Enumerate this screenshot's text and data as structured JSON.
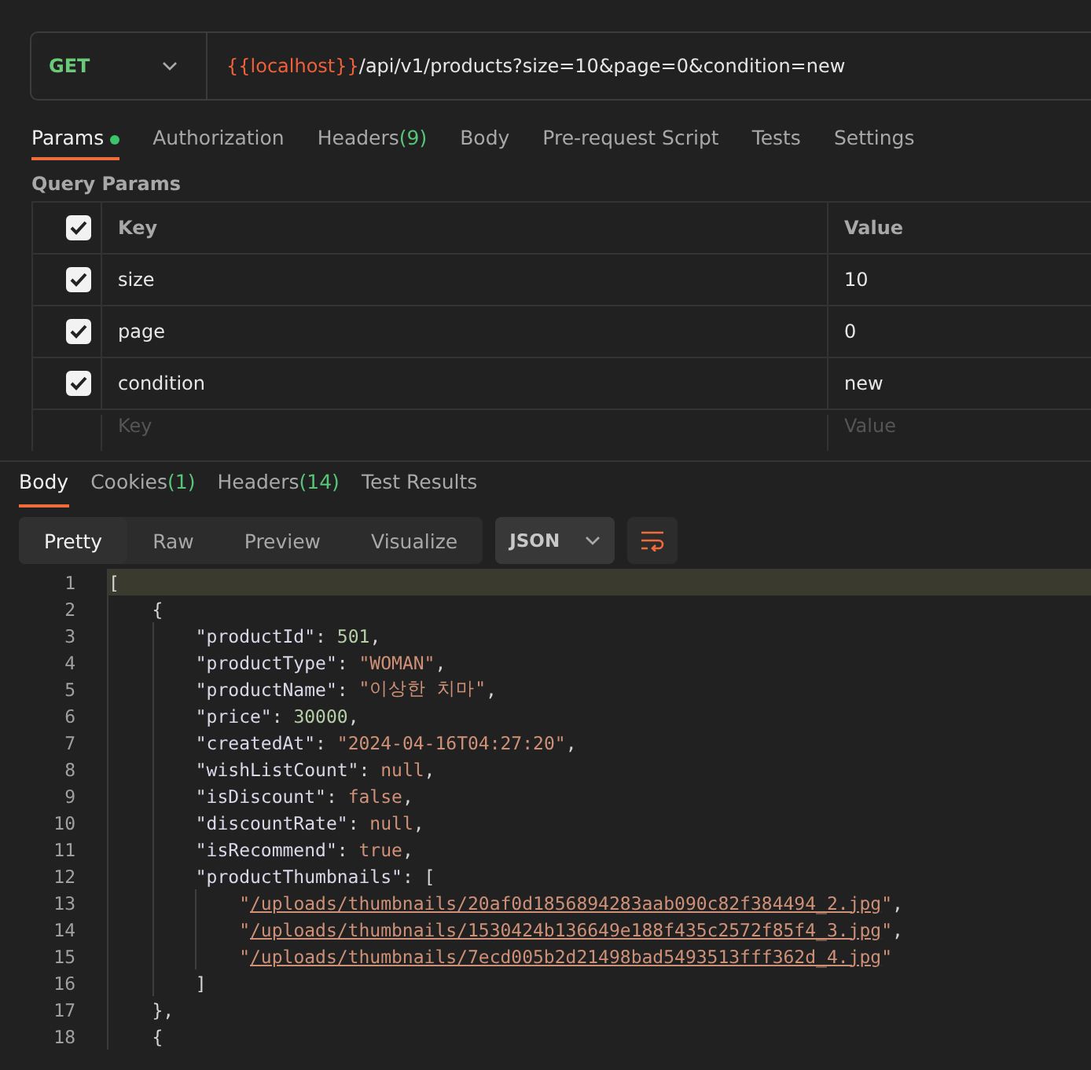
{
  "request": {
    "method": "GET",
    "url_variable": "{{localhost}}",
    "url_path": "/api/v1/products?size=10&page=0&condition=new"
  },
  "request_tabs": [
    {
      "label": "Params",
      "dot": true,
      "selected": true
    },
    {
      "label": "Authorization",
      "dot": false,
      "selected": false
    },
    {
      "label": "Headers",
      "count": "(9)",
      "dot": false,
      "selected": false
    },
    {
      "label": "Body",
      "dot": false,
      "selected": false
    },
    {
      "label": "Pre-request Script",
      "dot": false,
      "selected": false
    },
    {
      "label": "Tests",
      "dot": false,
      "selected": false
    },
    {
      "label": "Settings",
      "dot": false,
      "selected": false
    }
  ],
  "query_params": {
    "title": "Query Params",
    "header": {
      "checked": true,
      "key": "Key",
      "value": "Value"
    },
    "rows": [
      {
        "checked": true,
        "key": "size",
        "value": "10"
      },
      {
        "checked": true,
        "key": "page",
        "value": "0"
      },
      {
        "checked": true,
        "key": "condition",
        "value": "new"
      }
    ],
    "new_row": {
      "key_placeholder": "Key",
      "value_placeholder": "Value"
    }
  },
  "response_tabs": [
    {
      "label": "Body",
      "selected": true
    },
    {
      "label": "Cookies",
      "count": "(1)",
      "selected": false
    },
    {
      "label": "Headers",
      "count": "(14)",
      "selected": false
    },
    {
      "label": "Test Results",
      "selected": false
    }
  ],
  "view_modes": [
    {
      "label": "Pretty",
      "selected": true
    },
    {
      "label": "Raw",
      "selected": false
    },
    {
      "label": "Preview",
      "selected": false
    },
    {
      "label": "Visualize",
      "selected": false
    }
  ],
  "format": "JSON",
  "code_lines": [
    {
      "number": "1",
      "current": true,
      "tokens": [
        {
          "kind": "punct",
          "text": "["
        }
      ]
    },
    {
      "number": "2",
      "current": false,
      "tokens": [
        {
          "kind": "indent",
          "guide": false
        },
        {
          "kind": "punct",
          "text": "{"
        }
      ]
    },
    {
      "number": "3",
      "current": false,
      "tokens": [
        {
          "kind": "indent",
          "guide": false
        },
        {
          "kind": "indent",
          "guide": true
        },
        {
          "kind": "key",
          "text": "\"productId\""
        },
        {
          "kind": "punct",
          "text": ": "
        },
        {
          "kind": "number",
          "text": "501"
        },
        {
          "kind": "punct",
          "text": ","
        }
      ]
    },
    {
      "number": "4",
      "current": false,
      "tokens": [
        {
          "kind": "indent",
          "guide": false
        },
        {
          "kind": "indent",
          "guide": true
        },
        {
          "kind": "key",
          "text": "\"productType\""
        },
        {
          "kind": "punct",
          "text": ": "
        },
        {
          "kind": "string",
          "text": "\"WOMAN\""
        },
        {
          "kind": "punct",
          "text": ","
        }
      ]
    },
    {
      "number": "5",
      "current": false,
      "tokens": [
        {
          "kind": "indent",
          "guide": false
        },
        {
          "kind": "indent",
          "guide": true
        },
        {
          "kind": "key",
          "text": "\"productName\""
        },
        {
          "kind": "punct",
          "text": ": "
        },
        {
          "kind": "string",
          "text": "\"이상한 치마\""
        },
        {
          "kind": "punct",
          "text": ","
        }
      ]
    },
    {
      "number": "6",
      "current": false,
      "tokens": [
        {
          "kind": "indent",
          "guide": false
        },
        {
          "kind": "indent",
          "guide": true
        },
        {
          "kind": "key",
          "text": "\"price\""
        },
        {
          "kind": "punct",
          "text": ": "
        },
        {
          "kind": "number",
          "text": "30000"
        },
        {
          "kind": "punct",
          "text": ","
        }
      ]
    },
    {
      "number": "7",
      "current": false,
      "tokens": [
        {
          "kind": "indent",
          "guide": false
        },
        {
          "kind": "indent",
          "guide": true
        },
        {
          "kind": "key",
          "text": "\"createdAt\""
        },
        {
          "kind": "punct",
          "text": ": "
        },
        {
          "kind": "string",
          "text": "\"2024-04-16T04:27:20\""
        },
        {
          "kind": "punct",
          "text": ","
        }
      ]
    },
    {
      "number": "8",
      "current": false,
      "tokens": [
        {
          "kind": "indent",
          "guide": false
        },
        {
          "kind": "indent",
          "guide": true
        },
        {
          "kind": "key",
          "text": "\"wishListCount\""
        },
        {
          "kind": "punct",
          "text": ": "
        },
        {
          "kind": "literal",
          "text": "null"
        },
        {
          "kind": "punct",
          "text": ","
        }
      ]
    },
    {
      "number": "9",
      "current": false,
      "tokens": [
        {
          "kind": "indent",
          "guide": false
        },
        {
          "kind": "indent",
          "guide": true
        },
        {
          "kind": "key",
          "text": "\"isDiscount\""
        },
        {
          "kind": "punct",
          "text": ": "
        },
        {
          "kind": "literal",
          "text": "false"
        },
        {
          "kind": "punct",
          "text": ","
        }
      ]
    },
    {
      "number": "10",
      "current": false,
      "tokens": [
        {
          "kind": "indent",
          "guide": false
        },
        {
          "kind": "indent",
          "guide": true
        },
        {
          "kind": "key",
          "text": "\"discountRate\""
        },
        {
          "kind": "punct",
          "text": ": "
        },
        {
          "kind": "literal",
          "text": "null"
        },
        {
          "kind": "punct",
          "text": ","
        }
      ]
    },
    {
      "number": "11",
      "current": false,
      "tokens": [
        {
          "kind": "indent",
          "guide": false
        },
        {
          "kind": "indent",
          "guide": true
        },
        {
          "kind": "key",
          "text": "\"isRecommend\""
        },
        {
          "kind": "punct",
          "text": ": "
        },
        {
          "kind": "literal",
          "text": "true"
        },
        {
          "kind": "punct",
          "text": ","
        }
      ]
    },
    {
      "number": "12",
      "current": false,
      "tokens": [
        {
          "kind": "indent",
          "guide": false
        },
        {
          "kind": "indent",
          "guide": true
        },
        {
          "kind": "key",
          "text": "\"productThumbnails\""
        },
        {
          "kind": "punct",
          "text": ": ["
        }
      ]
    },
    {
      "number": "13",
      "current": false,
      "tokens": [
        {
          "kind": "indent",
          "guide": false
        },
        {
          "kind": "indent",
          "guide": true
        },
        {
          "kind": "indent",
          "guide": true
        },
        {
          "kind": "string",
          "text": "\""
        },
        {
          "kind": "link",
          "text": "/uploads/thumbnails/20af0d1856894283aab090c82f384494_2.jpg"
        },
        {
          "kind": "string",
          "text": "\""
        },
        {
          "kind": "punct",
          "text": ","
        }
      ]
    },
    {
      "number": "14",
      "current": false,
      "tokens": [
        {
          "kind": "indent",
          "guide": false
        },
        {
          "kind": "indent",
          "guide": true
        },
        {
          "kind": "indent",
          "guide": true
        },
        {
          "kind": "string",
          "text": "\""
        },
        {
          "kind": "link",
          "text": "/uploads/thumbnails/1530424b136649e188f435c2572f85f4_3.jpg"
        },
        {
          "kind": "string",
          "text": "\""
        },
        {
          "kind": "punct",
          "text": ","
        }
      ]
    },
    {
      "number": "15",
      "current": false,
      "tokens": [
        {
          "kind": "indent",
          "guide": false
        },
        {
          "kind": "indent",
          "guide": true
        },
        {
          "kind": "indent",
          "guide": true
        },
        {
          "kind": "string",
          "text": "\""
        },
        {
          "kind": "link",
          "text": "/uploads/thumbnails/7ecd005b2d21498bad5493513fff362d_4.jpg"
        },
        {
          "kind": "string",
          "text": "\""
        }
      ]
    },
    {
      "number": "16",
      "current": false,
      "tokens": [
        {
          "kind": "indent",
          "guide": false
        },
        {
          "kind": "indent",
          "guide": true
        },
        {
          "kind": "punct",
          "text": "]"
        }
      ]
    },
    {
      "number": "17",
      "current": false,
      "tokens": [
        {
          "kind": "indent",
          "guide": false
        },
        {
          "kind": "punct",
          "text": "},"
        }
      ]
    },
    {
      "number": "18",
      "current": false,
      "tokens": [
        {
          "kind": "indent",
          "guide": false
        },
        {
          "kind": "punct",
          "text": "{"
        }
      ]
    }
  ]
}
